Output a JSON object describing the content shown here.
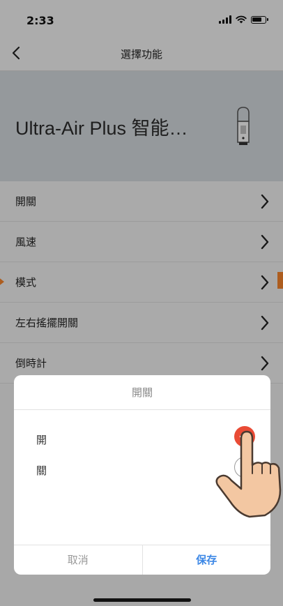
{
  "status_bar": {
    "time": "2:33"
  },
  "nav": {
    "title": "選擇功能",
    "back_icon": "chevron-left-icon"
  },
  "device": {
    "name": "Ultra-Air Plus 智能…"
  },
  "menu": [
    {
      "label": "開關"
    },
    {
      "label": "風速"
    },
    {
      "label": "模式"
    },
    {
      "label": "左右搖擺開關"
    },
    {
      "label": "倒時計"
    }
  ],
  "sheet": {
    "title": "開關",
    "options": [
      {
        "label": "開",
        "selected": true
      },
      {
        "label": "關",
        "selected": false
      }
    ],
    "cancel_label": "取消",
    "save_label": "保存"
  },
  "colors": {
    "accent": "#3d88e6",
    "radio_on": "#e94b35",
    "pointer": "#f0822b"
  }
}
